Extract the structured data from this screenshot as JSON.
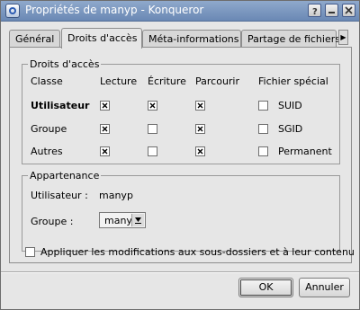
{
  "window": {
    "title": "Propriétés de manyp - Konqueror",
    "title_bar_color": "#7792bd"
  },
  "tabs": [
    {
      "label": "Général",
      "active": false
    },
    {
      "label": "Droits d'accès",
      "active": true
    },
    {
      "label": "Méta-informations",
      "active": false
    },
    {
      "label": "Partage de fichiers",
      "active": false
    }
  ],
  "permissions": {
    "legend": "Droits d'accès",
    "headers": {
      "class": "Classe",
      "read": "Lecture",
      "write": "Écriture",
      "browse": "Parcourir",
      "special": "Fichier spécial"
    },
    "rows": [
      {
        "label": "Utilisateur",
        "read": true,
        "write": true,
        "browse": true,
        "special_label": "SUID",
        "special": false
      },
      {
        "label": "Groupe",
        "read": true,
        "write": false,
        "browse": true,
        "special_label": "SGID",
        "special": false
      },
      {
        "label": "Autres",
        "read": true,
        "write": false,
        "browse": true,
        "special_label": "Permanent",
        "special": false
      }
    ]
  },
  "ownership": {
    "legend": "Appartenance",
    "user_label": "Utilisateur :",
    "user_value": "manyp",
    "group_label": "Groupe :",
    "group_value": "manyp"
  },
  "apply_recursive": {
    "label": "Appliquer les modifications aux sous-dossiers et à leur contenu",
    "checked": false
  },
  "buttons": {
    "ok": "OK",
    "cancel": "Annuler"
  }
}
